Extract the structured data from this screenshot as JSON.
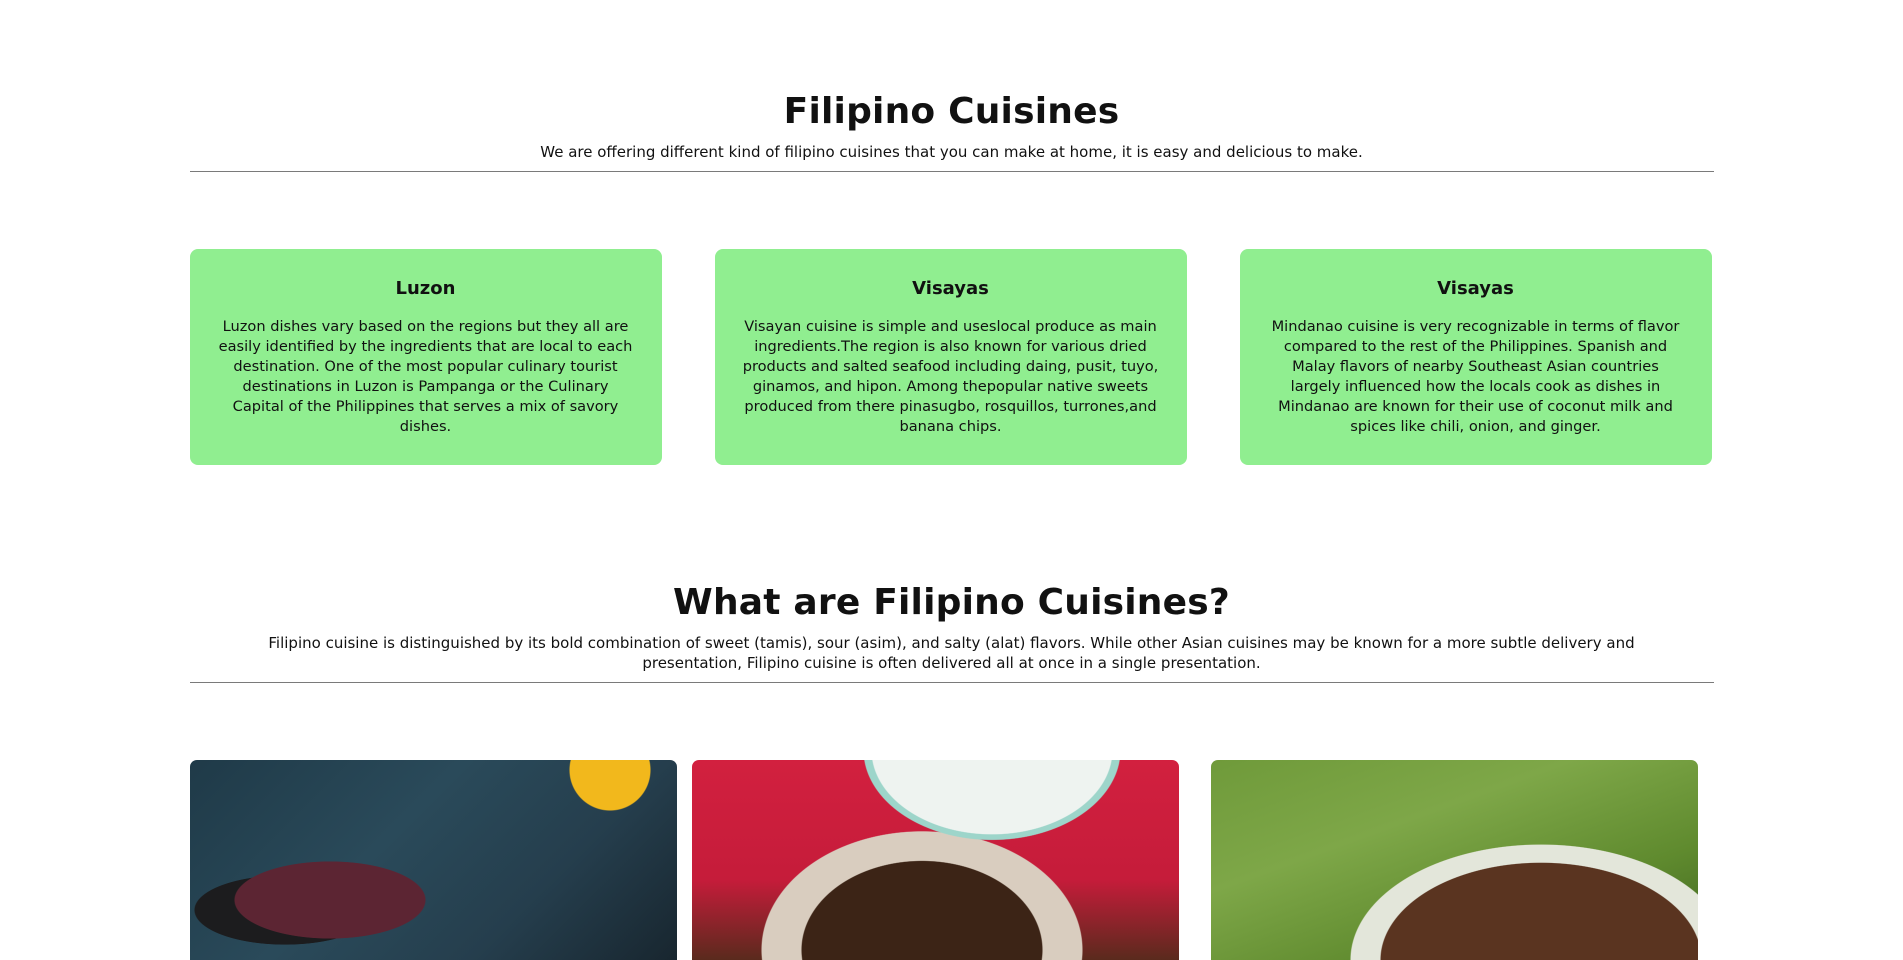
{
  "section_regions": {
    "title": "Filipino Cuisines",
    "subtitle": "We are offering different kind of filipino cuisines that you can make at home, it is easy and delicious to make.",
    "cards": [
      {
        "title": "Luzon",
        "text": "Luzon dishes vary based on the regions but they all are easily identified by the ingredients that are local to each destination. One of the most popular culinary tourist destinations in Luzon is Pampanga or the Culinary Capital of the Philippines that serves a mix of savory dishes."
      },
      {
        "title": "Visayas",
        "text": "Visayan cuisine is simple and useslocal produce as main ingredients.The region is also known for various dried products and salted seafood including daing, pusit, tuyo, ginamos, and hipon. Among thepopular native sweets produced from there pinasugbo, rosquillos, turrones,and banana chips."
      },
      {
        "title": "Visayas",
        "text": "Mindanao cuisine is very recognizable in terms of flavor compared to the rest of the Philippines. Spanish and Malay flavors of nearby Southeast Asian countries largely influenced how the locals cook as dishes in Mindanao are known for their use of coconut milk and spices like chili, onion, and ginger."
      }
    ]
  },
  "section_about": {
    "title": "What are Filipino Cuisines?",
    "subtitle": "Filipino cuisine is distinguished by its bold combination of sweet (tamis), sour (asim), and salty (alat) flavors. While other Asian cuisines may be known for a more subtle delivery and presentation, Filipino cuisine is often delivered all at once in a single presentation."
  },
  "photos": [
    "food-photo-skillet",
    "food-photo-bowl",
    "food-photo-beef"
  ],
  "colors": {
    "card_background": "#90ee90",
    "divider": "#7a7a7a",
    "text": "#111111"
  }
}
